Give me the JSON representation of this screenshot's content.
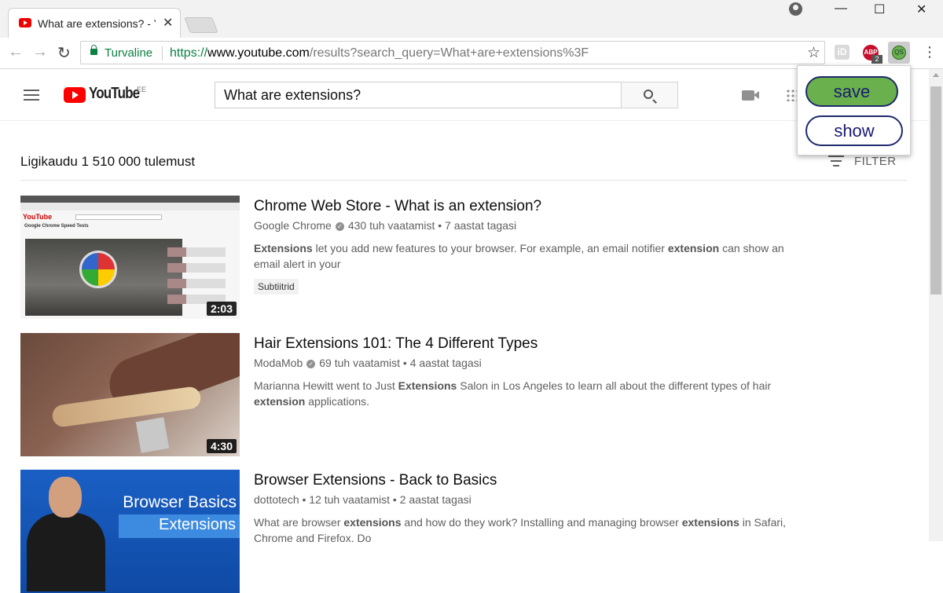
{
  "browser": {
    "tab_title": "What are extensions? - YouTube",
    "tab_close": "✕",
    "secure_label": "Turvaline",
    "url_scheme": "https://",
    "url_host": "www.youtube.com",
    "url_path": "/results?search_query=What+are+extensions%3F",
    "minimize": "—",
    "maximize": "☐",
    "close": "✕",
    "back": "←",
    "forward": "→",
    "reload": "↻",
    "star": "☆",
    "ext_id_label": "iD",
    "ext_abp_label": "ABP",
    "ext_abp_badge": "2",
    "ext_qs_label": "QS",
    "menu": "⋮"
  },
  "youtube": {
    "logo_text": "YouTube",
    "region": "EE",
    "search_value": "What are extensions?",
    "result_count": "Ligikaudu 1 510 000 tulemust",
    "filter_label": "FILTER"
  },
  "videos": [
    {
      "title": "Chrome Web Store - What is an extension?",
      "channel": "Google Chrome",
      "verified": "✓",
      "views": "430 tuh vaatamist",
      "age": "7 aastat tagasi",
      "desc_parts": [
        "Extensions",
        " let you add new features to your browser. For example, an email notifier ",
        "extension",
        " can show an email alert in your"
      ],
      "badge": "Subtiitrid",
      "duration": "2:03",
      "thumb_logo": "YouTube",
      "thumb_heading": "Google Chrome Speed Tests"
    },
    {
      "title": "Hair Extensions 101: The 4 Different Types",
      "channel": "ModaMob",
      "verified": "✓",
      "views": "69 tuh vaatamist",
      "age": "4 aastat tagasi",
      "desc_parts": [
        "Marianna Hewitt went to Just ",
        "Extensions",
        " Salon in Los Angeles to learn all about the different types of hair ",
        "extension",
        " applications."
      ],
      "duration": "4:30"
    },
    {
      "title": "Browser Extensions - Back to Basics",
      "channel": "dottotech",
      "views": "12 tuh vaatamist",
      "age": "2 aastat tagasi",
      "desc_parts": [
        "What are browser ",
        "extensions",
        " and how do they work? Installing and managing browser ",
        "extensions",
        " in Safari, Chrome and Firefox. Do"
      ],
      "thumb_title": "Browser Basics",
      "thumb_sub": "Extensions"
    }
  ],
  "popup": {
    "save_label": "save",
    "show_label": "show"
  },
  "colors": {
    "secure_green": "#0b8043",
    "youtube_red": "#ff0000",
    "save_green": "#6ab04c",
    "popup_border": "#1e2a6b"
  }
}
